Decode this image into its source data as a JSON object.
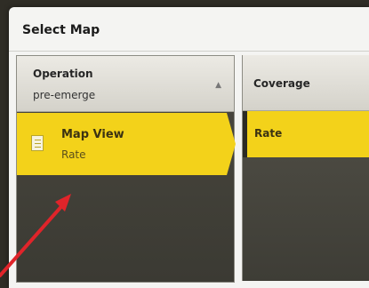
{
  "dialog": {
    "title": "Select Map"
  },
  "operation": {
    "label": "Operation",
    "value": "pre-emerge"
  },
  "map_list": {
    "items": [
      {
        "title": "Map View",
        "subtitle": "Rate",
        "icon": "document-icon",
        "selected": true
      }
    ]
  },
  "coverage": {
    "label": "Coverage",
    "items": [
      {
        "label": "Rate",
        "selected": true
      }
    ]
  },
  "colors": {
    "selection": "#f3d21a",
    "panel_dark": "#3b3a33",
    "annotation_arrow": "#e0242a"
  }
}
